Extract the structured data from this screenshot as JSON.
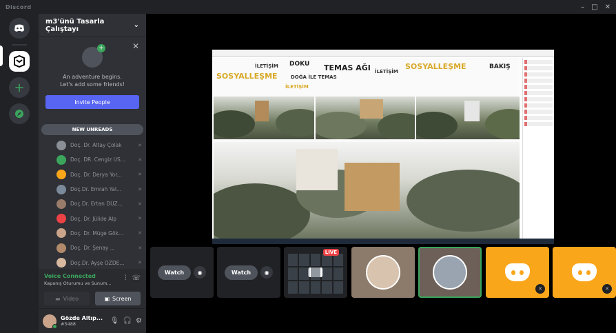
{
  "titlebar": {
    "app_name": "Discord",
    "minimize": "–",
    "maximize": "□",
    "close": "✕"
  },
  "server": {
    "name": "m3'ünü Tasarla Çalıştayı"
  },
  "invite": {
    "line1": "An adventure begins.",
    "line2": "Let's add some friends!",
    "button": "Invite People"
  },
  "new_unreads": "NEW UNREADS",
  "voice_users": [
    {
      "name": "Doç. Dr. Altay Çolak",
      "color": "#8a8f96"
    },
    {
      "name": "Doç. DR. Cengiz US...",
      "color": "#3ba55c"
    },
    {
      "name": "Doç. Dr. Derya Yor...",
      "color": "#faa61a"
    },
    {
      "name": "Doç.Dr. Emrah Yal...",
      "color": "#7a8a9a"
    },
    {
      "name": "Doç.Dr. Ertan DÜZ...",
      "color": "#9a7c6a"
    },
    {
      "name": "Doç. Dr. Jülide Alp",
      "color": "#ed4245"
    },
    {
      "name": "Doç. Dr. Müge Gök...",
      "color": "#c9a48a"
    },
    {
      "name": "Doç. Dr. Şenay ...",
      "color": "#b08a6a"
    },
    {
      "name": "Doç.Dr. Ayşe ÖZDE...",
      "color": "#d8b9a0"
    }
  ],
  "voice": {
    "status": "Voice Connected",
    "channel": "Kapanış Oturumu ve Sunum...",
    "video": "Video",
    "screen": "Screen"
  },
  "user": {
    "name": "Gözde Altıp...",
    "tag": "#5488"
  },
  "slide": {
    "words": [
      "İLETİŞİM",
      "DOKU",
      "TEMAS AĞI",
      "İLETİŞİM",
      "SOSYALLEŞME",
      "BAKIŞ",
      "SOSYALLEŞME",
      "DOĞA İLE TEMAS",
      "İLETİŞİM"
    ]
  },
  "tiles": {
    "watch": "Watch",
    "live": "LIVE"
  },
  "colors": {
    "accent": "#5865f2",
    "green": "#3ba55c",
    "orange": "#faa61a",
    "red": "#ed4245"
  }
}
